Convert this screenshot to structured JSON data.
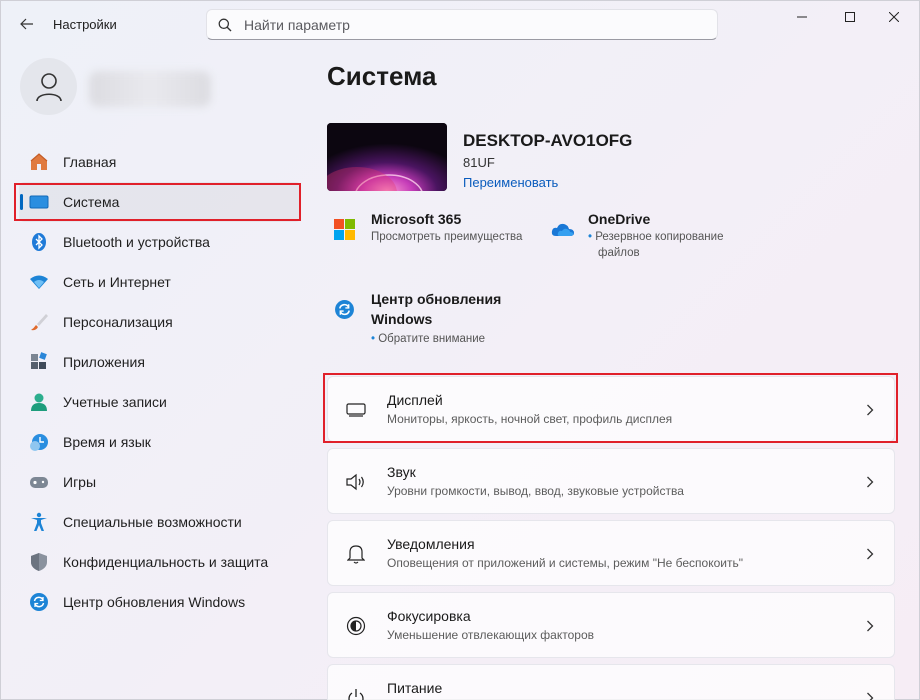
{
  "app": {
    "title": "Настройки"
  },
  "search": {
    "placeholder": "Найти параметр"
  },
  "sidebar": {
    "items": [
      {
        "label": "Главная",
        "icon": "home-icon"
      },
      {
        "label": "Система",
        "icon": "system-icon",
        "selected": true
      },
      {
        "label": "Bluetooth и устройства",
        "icon": "bluetooth-icon"
      },
      {
        "label": "Сеть и Интернет",
        "icon": "wifi-icon"
      },
      {
        "label": "Персонализация",
        "icon": "brush-icon"
      },
      {
        "label": "Приложения",
        "icon": "apps-icon"
      },
      {
        "label": "Учетные записи",
        "icon": "account-icon"
      },
      {
        "label": "Время и язык",
        "icon": "clock-globe-icon"
      },
      {
        "label": "Игры",
        "icon": "gamepad-icon"
      },
      {
        "label": "Специальные возможности",
        "icon": "accessibility-icon"
      },
      {
        "label": "Конфиденциальность и защита",
        "icon": "shield-icon"
      },
      {
        "label": "Центр обновления Windows",
        "icon": "update-icon"
      }
    ]
  },
  "main": {
    "title": "Система",
    "device": {
      "name": "DESKTOP-AVO1OFG",
      "model": "81UF",
      "rename_label": "Переименовать"
    },
    "tiles": {
      "m365": {
        "title": "Microsoft 365",
        "subtitle": "Просмотреть преимущества"
      },
      "onedrive": {
        "title": "OneDrive",
        "subtitle_line1": "Резервное копирование",
        "subtitle_line2": "файлов"
      },
      "update": {
        "title_line1": "Центр обновления",
        "title_line2": "Windows",
        "subtitle": "Обратите внимание"
      }
    },
    "cards": [
      {
        "title": "Дисплей",
        "subtitle": "Мониторы, яркость, ночной свет, профиль дисплея",
        "icon": "monitor-icon"
      },
      {
        "title": "Звук",
        "subtitle": "Уровни громкости, вывод, ввод, звуковые устройства",
        "icon": "speaker-icon"
      },
      {
        "title": "Уведомления",
        "subtitle": "Оповещения от приложений и системы, режим \"Не беспокоить\"",
        "icon": "bell-icon"
      },
      {
        "title": "Фокусировка",
        "subtitle": "Уменьшение отвлекающих факторов",
        "icon": "focus-icon"
      },
      {
        "title": "Питание",
        "subtitle": "",
        "icon": "power-icon"
      }
    ]
  },
  "colors": {
    "accent": "#0067c0",
    "highlight": "#e0202a",
    "link": "#0a5cbd"
  }
}
